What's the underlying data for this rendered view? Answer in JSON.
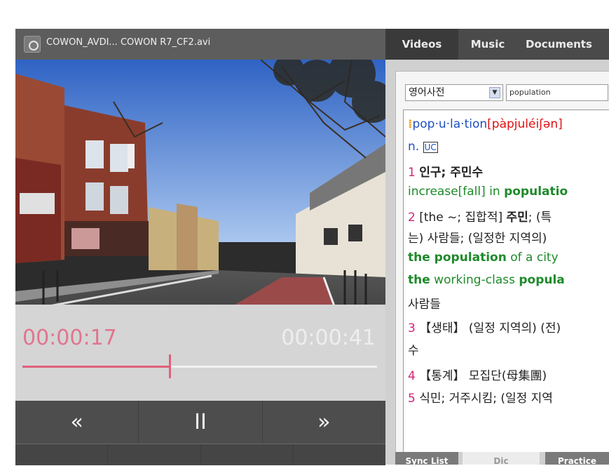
{
  "player": {
    "file_title": "COWON_AVDI...  COWON R7_CF2.avi",
    "app_icon": "cowon-app-icon",
    "elapsed": "00:00:17",
    "total": "00:00:41",
    "progress": 0.415,
    "controls": {
      "rewind": "«",
      "pause": "II",
      "forward": "»"
    }
  },
  "tabs": [
    "Videos",
    "Music",
    "Documents"
  ],
  "dictionary": {
    "selected": "영어사전",
    "query": "population",
    "entry": {
      "headword": "pop·u·la·tion",
      "pronunciation": "[pàpjuléiʃən]",
      "pos": "n.",
      "uc": "UC",
      "def1_num": "1",
      "def1": "인구; 주민수",
      "ex1_a": "increase[fall] in ",
      "ex1_b": "populatio",
      "def2_num": "2",
      "def2_a": "[the ~; 집합적] ",
      "def2_b": "주민",
      "def2_c": "; (특",
      "def2_line2": "는) 사람들; (일정한 지역의)",
      "ex2_a": "the population",
      "ex2_b": " of a city",
      "ex3_a": "the",
      "ex3_b": " working-class ",
      "ex3_c": "popula",
      "ex3_line2": "사람들",
      "def3_num": "3",
      "def3": "【생태】 (일정 지역의) (전)",
      "def3_line2": "수",
      "def4_num": "4",
      "def4": "【통계】 모집단(母集團)",
      "def5_num": "5",
      "def5": "식민; 거주시킴; (일정 지역"
    }
  },
  "bottom_tabs": [
    "Sync List",
    "Dic",
    "Practice"
  ]
}
